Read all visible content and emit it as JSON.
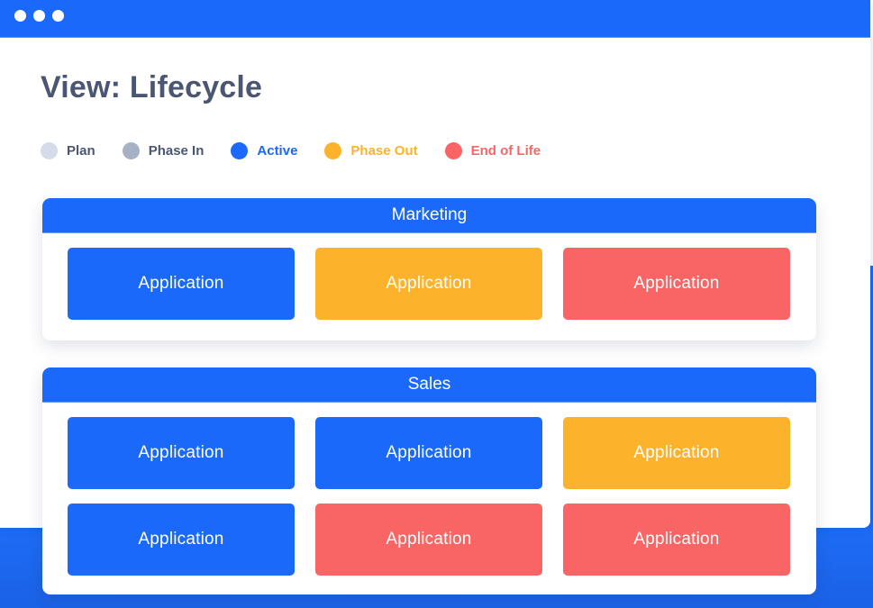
{
  "window": {
    "title_dots": 3,
    "page_title": "View: Lifecycle"
  },
  "colors": {
    "brand_blue": "#1b69fa",
    "plan": "#d5dce9",
    "phase_in": "#a6b1c6",
    "active": "#1b69fa",
    "phase_out": "#fdb22b",
    "end_of_life": "#f96565",
    "title_text": "#4a5672"
  },
  "legend": [
    {
      "label": "Plan",
      "dot_color": "#d5dce9",
      "text_color": "#4a5672",
      "status": "plan"
    },
    {
      "label": "Phase In",
      "dot_color": "#a6b1c6",
      "text_color": "#4a5672",
      "status": "phase-in"
    },
    {
      "label": "Active",
      "dot_color": "#1b69fa",
      "text_color": "#1b69fa",
      "status": "active"
    },
    {
      "label": "Phase Out",
      "dot_color": "#fdb22b",
      "text_color": "#fdb22b",
      "status": "phase-out"
    },
    {
      "label": "End of Life",
      "dot_color": "#f96565",
      "text_color": "#f96565",
      "status": "eol"
    }
  ],
  "groups": [
    {
      "name": "Marketing",
      "applications": [
        {
          "label": "Application",
          "status": "active"
        },
        {
          "label": "Application",
          "status": "phase-out"
        },
        {
          "label": "Application",
          "status": "eol"
        }
      ]
    },
    {
      "name": "Sales",
      "applications": [
        {
          "label": "Application",
          "status": "active"
        },
        {
          "label": "Application",
          "status": "active"
        },
        {
          "label": "Application",
          "status": "phase-out"
        },
        {
          "label": "Application",
          "status": "active"
        },
        {
          "label": "Application",
          "status": "eol"
        },
        {
          "label": "Application",
          "status": "eol"
        }
      ]
    }
  ]
}
